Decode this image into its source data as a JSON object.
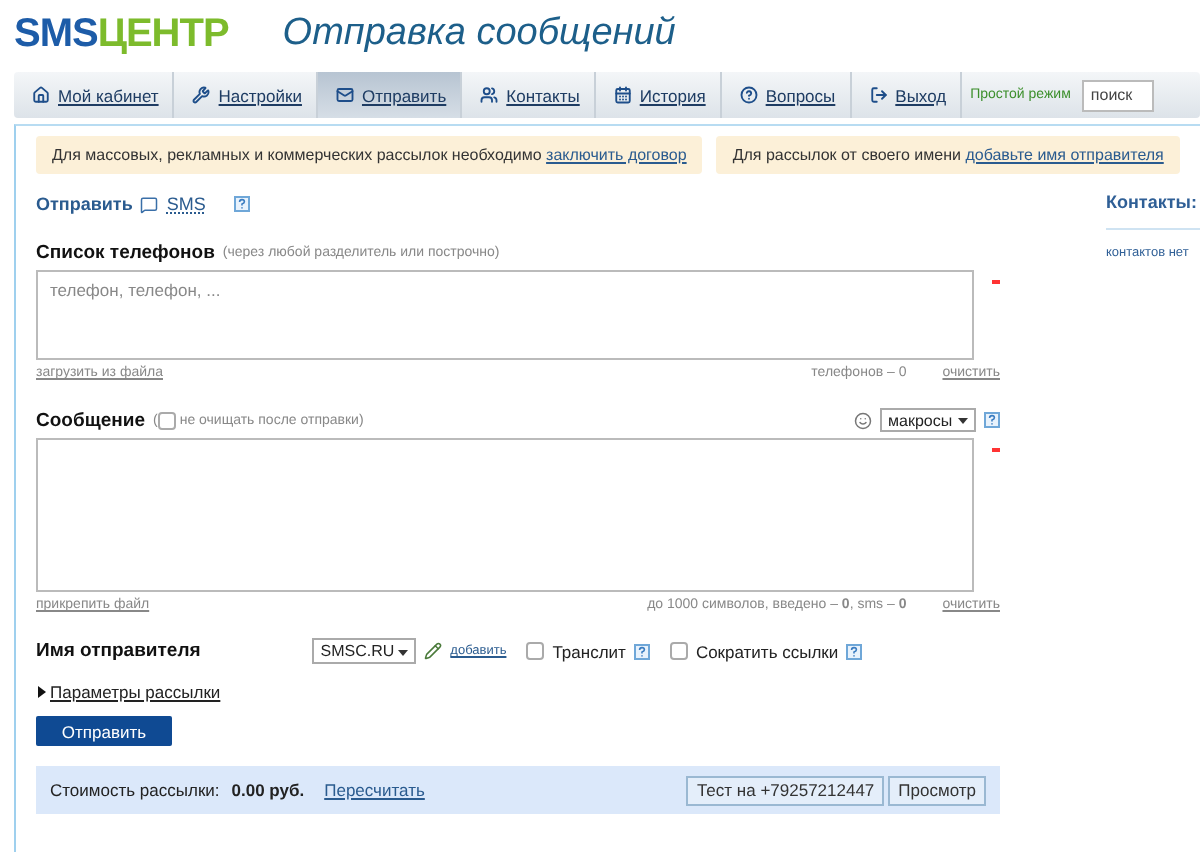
{
  "header": {
    "logo_left": "SMS",
    "logo_right": "ЦЕНТР",
    "title": "Отправка сообщений"
  },
  "nav": {
    "tabs": [
      {
        "label": "Мой кабинет",
        "selected": false
      },
      {
        "label": "Настройки",
        "selected": false
      },
      {
        "label": "Отправить",
        "selected": true
      },
      {
        "label": "Контакты",
        "selected": false
      },
      {
        "label": "История",
        "selected": false
      },
      {
        "label": "Вопросы",
        "selected": false
      },
      {
        "label": "Выход",
        "selected": false
      }
    ],
    "mode_link": "Простой режим",
    "search": {
      "placeholder": "поиск"
    }
  },
  "notices": [
    {
      "text": "Для массовых, рекламных и коммерческих рассылок необходимо",
      "link": "заключить договор"
    },
    {
      "text": "Для рассылок от своего имени",
      "link": "добавьте имя отправителя"
    }
  ],
  "send_mode": {
    "label": "Отправить",
    "type": "SMS"
  },
  "phones": {
    "label": "Список телефонов",
    "hint": "(через любой разделитель или построчно)",
    "placeholder": "телефон, телефон, ...",
    "upload_link": "загрузить из файла",
    "count": "телефонов – 0",
    "clear_link": "очистить"
  },
  "message": {
    "label": "Сообщение",
    "keep_open": "(",
    "keep_hint": "не очищать после отправки)",
    "keep_checked": false,
    "macros": "макросы",
    "attach_link": "прикрепить файл",
    "counter": "до 1000 символов, введено – **0**, sms – **0**",
    "clear_link": "очистить"
  },
  "sender": {
    "label": "Имя отправителя",
    "value": "SMSC.RU",
    "add_link": "добавить",
    "options": [
      {
        "label": "Транслит",
        "checked": false
      },
      {
        "label": "Сократить ссылки",
        "checked": false
      }
    ]
  },
  "params": {
    "label": "Параметры рассылки",
    "expanded": false
  },
  "submit": "Отправить",
  "cost": {
    "label": "Стоимость рассылки:",
    "value": "0.00 руб.",
    "recalc_link": "Пересчитать",
    "buttons": [
      "Тест на +79257212447",
      "Просмотр"
    ]
  },
  "contacts": {
    "title": "Контакты:",
    "empty": "контактов нет"
  }
}
